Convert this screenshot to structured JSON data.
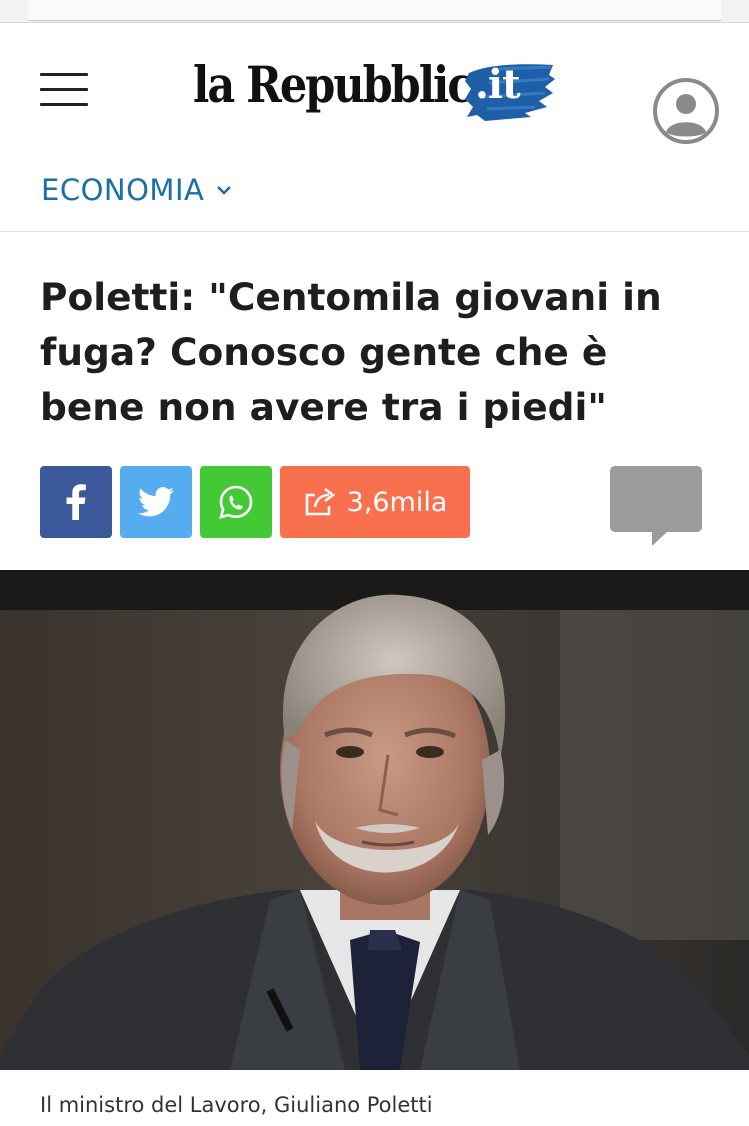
{
  "header": {
    "logo_text": "la Repubblica",
    "logo_tld": ".it",
    "menu_icon": "hamburger-icon",
    "user_icon": "user-account-icon"
  },
  "section": {
    "label": "ECONOMIA",
    "icon": "chevron-down-icon",
    "color": "#1a6fa5"
  },
  "article": {
    "headline": "Poletti: \"Centomila giovani in fuga? Conosco gente che è bene non avere tra i piedi\"",
    "caption": "Il ministro del Lavoro, Giuliano Poletti"
  },
  "share": {
    "facebook_icon": "facebook-icon",
    "twitter_icon": "twitter-icon",
    "whatsapp_icon": "whatsapp-icon",
    "share_icon": "share-arrow-icon",
    "count_label": "3,6mila",
    "comment_icon": "comment-bubble-icon",
    "colors": {
      "facebook": "#3b5998",
      "twitter": "#55acee",
      "whatsapp": "#43c936",
      "share": "#f9704f",
      "comment": "#9b9b9b"
    }
  },
  "photo": {
    "subject": "portrait-photo"
  }
}
